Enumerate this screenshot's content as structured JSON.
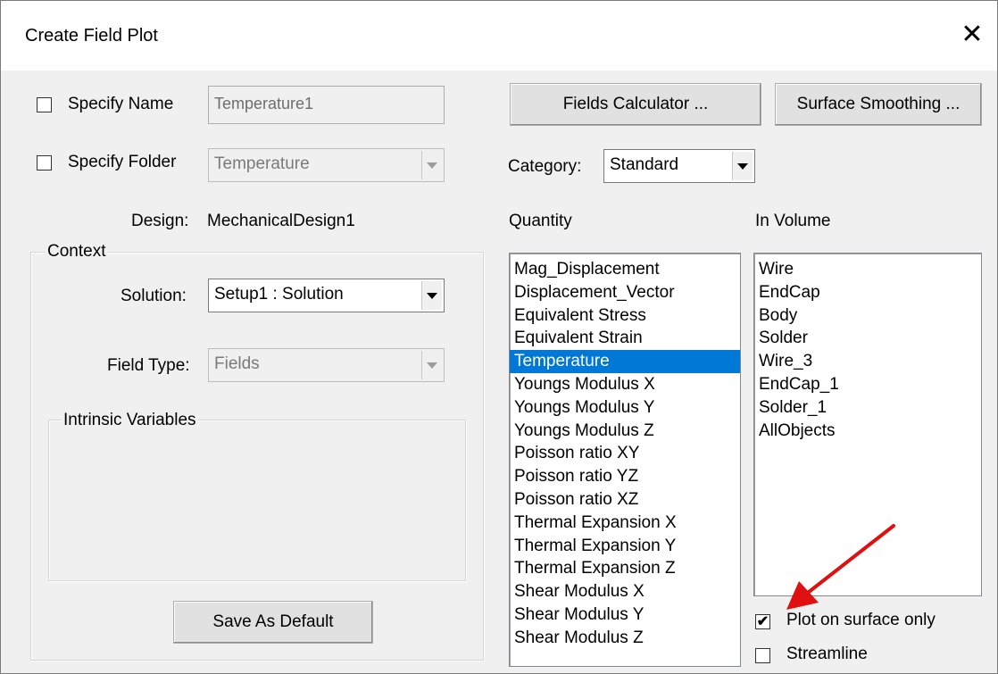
{
  "window": {
    "title": "Create Field Plot",
    "close_glyph": "✕"
  },
  "specify_name": {
    "label": "Specify Name",
    "checked": false,
    "value": "Temperature1"
  },
  "specify_folder": {
    "label": "Specify Folder",
    "checked": false,
    "value": "Temperature"
  },
  "fields_calculator_label": "Fields Calculator ...",
  "surface_smoothing_label": "Surface Smoothing ...",
  "category": {
    "label": "Category:",
    "value": "Standard"
  },
  "design": {
    "label": "Design:",
    "value": "MechanicalDesign1"
  },
  "context": {
    "label": "Context",
    "solution": {
      "label": "Solution:",
      "value": "Setup1 : Solution"
    },
    "field_type": {
      "label": "Field Type:",
      "value": "Fields"
    },
    "intrinsic_label": "Intrinsic Variables",
    "save_default_label": "Save As Default"
  },
  "quantity": {
    "label": "Quantity",
    "items": [
      "Mag_Displacement",
      "Displacement_Vector",
      "Equivalent Stress",
      "Equivalent Strain",
      "Temperature",
      "Youngs Modulus X",
      "Youngs Modulus Y",
      "Youngs Modulus Z",
      "Poisson ratio XY",
      "Poisson ratio YZ",
      "Poisson ratio XZ",
      "Thermal Expansion X",
      "Thermal Expansion Y",
      "Thermal Expansion Z",
      "Shear Modulus X",
      "Shear Modulus Y",
      "Shear Modulus Z"
    ],
    "selected": "Temperature"
  },
  "in_volume": {
    "label": "In Volume",
    "items": [
      "Wire",
      "EndCap",
      "Body",
      "Solder",
      "Wire_3",
      "EndCap_1",
      "Solder_1",
      "AllObjects"
    ]
  },
  "plot_on_surface": {
    "label": "Plot on surface only",
    "checked": true
  },
  "streamline": {
    "label": "Streamline",
    "checked": false
  },
  "colors": {
    "selection": "#0078d7",
    "annotation_arrow": "#e01010"
  }
}
